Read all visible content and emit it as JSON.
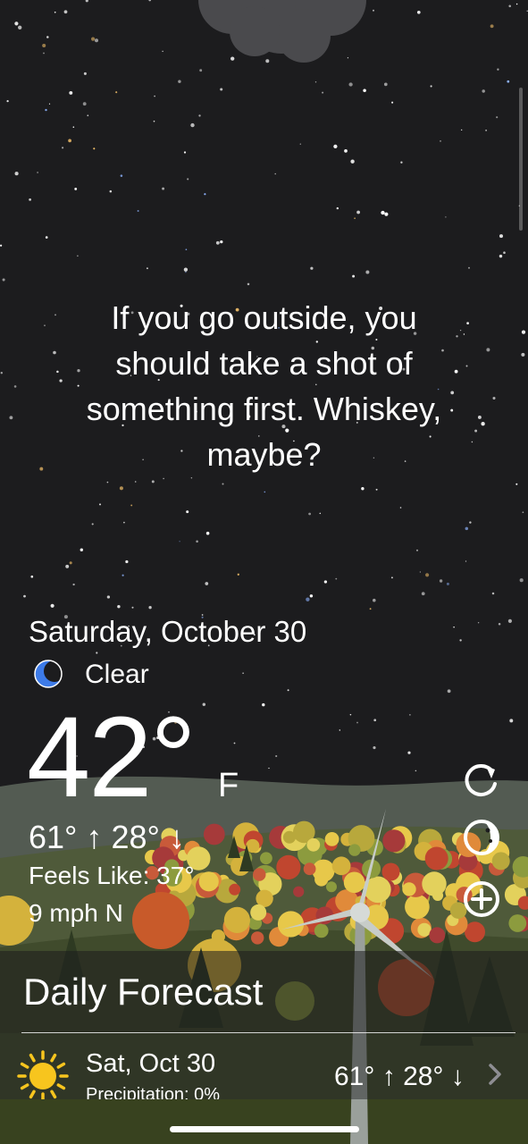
{
  "quote": {
    "line1": "If you go outside, you",
    "line2": "should take a shot of",
    "line3": "something first. Whiskey,",
    "line4": "maybe?"
  },
  "current": {
    "date": "Saturday, October 30",
    "condition": "Clear",
    "condition_icon": "moon-icon",
    "temperature": "42°",
    "unit": "F",
    "high": "61°",
    "low": "28°",
    "feels_like": "Feels Like: 37°",
    "wind": "9 mph N"
  },
  "side_buttons": [
    "refresh-icon",
    "moon-phase-icon",
    "add-icon"
  ],
  "forecast": {
    "title": "Daily Forecast",
    "days": [
      {
        "date": "Sat, Oct 30",
        "precip": "Precipitation: 0%",
        "high": "61°",
        "low": "28°",
        "icon": "sun-icon"
      }
    ]
  },
  "colors": {
    "sky": "#1c1c1e",
    "moon": "#3d7be8",
    "sun": "#f7c51e"
  }
}
